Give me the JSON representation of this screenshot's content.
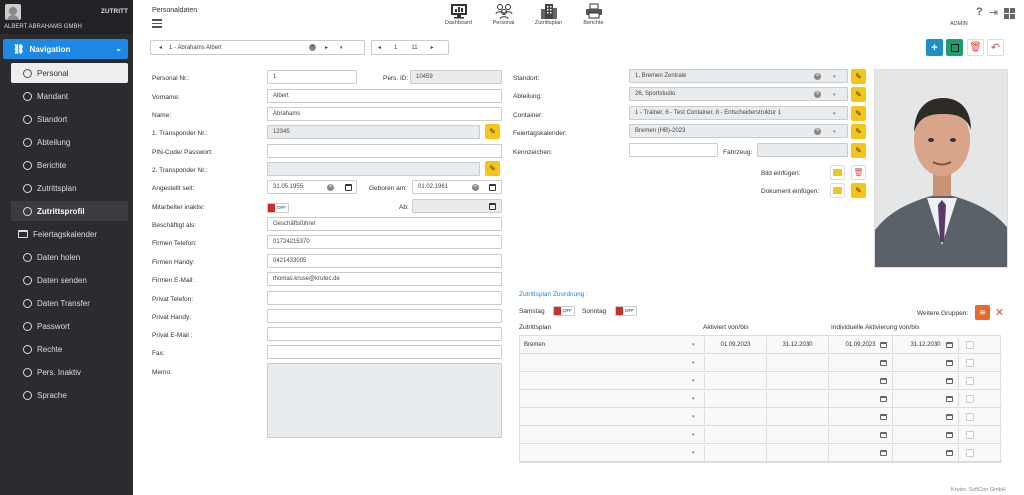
{
  "sidebar": {
    "user": "ALBERT ABRAHAMS GMBH",
    "brand": "ZUTRITT",
    "nav_label": "Navigation",
    "items": [
      {
        "label": "Personal"
      },
      {
        "label": "Mandant"
      },
      {
        "label": "Standort"
      },
      {
        "label": "Abteilung"
      },
      {
        "label": "Berichte"
      },
      {
        "label": "Zutrittsplan"
      },
      {
        "label": "Zutrittsprofil"
      },
      {
        "label": "Feiertagskalender"
      },
      {
        "label": "Daten holen"
      },
      {
        "label": "Daten senden"
      },
      {
        "label": "Daten Transfer"
      },
      {
        "label": "Passwort"
      },
      {
        "label": "Rechte"
      },
      {
        "label": "Pers. Inaktiv"
      },
      {
        "label": "Sprache"
      }
    ]
  },
  "header": {
    "title": "Personaldaten",
    "icons": [
      {
        "label": "Dashboard",
        "icon": "dashboard-icon"
      },
      {
        "label": "Personal",
        "icon": "people-icon"
      },
      {
        "label": "Zutrittsplan",
        "icon": "building-icon"
      },
      {
        "label": "Berichte",
        "icon": "printer-icon"
      }
    ],
    "admin": "ADMIN"
  },
  "record_nav": {
    "current": "1 - Abrahams Albert",
    "page": "1",
    "total": "11"
  },
  "form": {
    "personal_nr_label": "Personal Nr.:",
    "personal_nr": "1",
    "pers_id_label": "Pers. ID:",
    "pers_id": "10459",
    "vorname_label": "Vorname:",
    "vorname": "Albert",
    "name_label": "Name:",
    "name": "Abrahams",
    "transponder1_label": "1. Transponder Nr.:",
    "transponder1": "12345",
    "pin_label": "PIN-Code/ Passwort:",
    "transponder2_label": "2. Transponder Nr.:",
    "angestellt_label": "Angestellt seit:",
    "angestellt": "31.05.1955",
    "geboren_label": "Geboren am:",
    "geboren": "01.02.1961",
    "inaktiv_label": "Mitarbeiter inaktiv:",
    "ab_label": "Ab:",
    "off_text": "OFF",
    "beschaeftigt_label": "Beschäftigt als:",
    "beschaeftigt": "Geschäftsführer",
    "firmen_tel_label": "Firmen Telefon:",
    "firmen_tel": "01724215370",
    "firmen_handy_label": "Firmen Handy:",
    "firmen_handy": "0421433005",
    "firmen_email_label": "Firmen E-Mail:",
    "firmen_email": "thomas.kruse@krutec.de",
    "privat_tel_label": "Privat Telefon:",
    "privat_handy_label": "Privat Handy:",
    "privat_email_label": "Privat E-Mail :",
    "fax_label": "Fax:",
    "memo_label": "Memo:"
  },
  "right": {
    "standort_label": "Standort:",
    "standort": "1, Bremen Zentrale",
    "abteilung_label": "Abteilung:",
    "abteilung": "26, Sportstudio",
    "container_label": "Container:",
    "container": "1 - Trainer, 6 - Test Container, 8 - Entscheiderstruktur 1",
    "feiertag_label": "Feiertagskalender:",
    "feiertag": "Bremen (HB)-2023",
    "kennzeichen_label": "Kennzeichen:",
    "fahrzeug_label": "Fahrzeug:",
    "bild_label": "Bild einfügen:",
    "dokument_label": "Dokument einfügen:"
  },
  "zutritt": {
    "title": "Zutrittsplan Zuordnung :",
    "samstag": "Samstag",
    "sonntag": "Sonntag",
    "weitere": "Weitere Gruppen:",
    "col_plan": "Zutrittsplan",
    "col_aktiv": "Aktiviert von/bis",
    "col_indiv": "Individuelle Aktivierung von/bis",
    "rows": [
      {
        "plan": "Bremen",
        "von": "01.09.2023",
        "bis": "31.12.2030",
        "ivon": "01.09.2023",
        "ibis": "31.12.2030"
      },
      {
        "plan": "",
        "von": "",
        "bis": "",
        "ivon": "",
        "ibis": ""
      },
      {
        "plan": "",
        "von": "",
        "bis": "",
        "ivon": "",
        "ibis": ""
      },
      {
        "plan": "",
        "von": "",
        "bis": "",
        "ivon": "",
        "ibis": ""
      },
      {
        "plan": "",
        "von": "",
        "bis": "",
        "ivon": "",
        "ibis": ""
      },
      {
        "plan": "",
        "von": "",
        "bis": "",
        "ivon": "",
        "ibis": ""
      },
      {
        "plan": "",
        "von": "",
        "bis": "",
        "ivon": "",
        "ibis": ""
      }
    ]
  },
  "footer": "Krutec SoftCon GmbH",
  "colors": {
    "primary": "#1e88e5",
    "sidebar": "#2a2c2f",
    "edit": "#f5c518",
    "danger": "#d9534f",
    "save": "#1a9e6e",
    "add": "#1e90c8"
  }
}
